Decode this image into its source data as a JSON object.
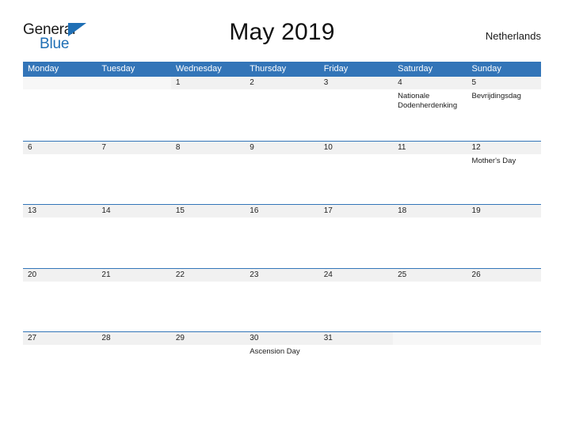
{
  "brand": {
    "name_part1": "General",
    "name_part2": "Blue",
    "flag_icon": "triangle-flag-icon",
    "accent_color": "#1f6fb5"
  },
  "header": {
    "title": "May 2019",
    "country": "Netherlands"
  },
  "colors": {
    "header_band": "#3375b8",
    "day_strip": "#f1f1f1",
    "separator": "#3375b8",
    "text": "#1a1a1a"
  },
  "calendar": {
    "month": "May",
    "year": "2019",
    "weekday_headers": [
      "Monday",
      "Tuesday",
      "Wednesday",
      "Thursday",
      "Friday",
      "Saturday",
      "Sunday"
    ],
    "weeks": [
      {
        "days": [
          {
            "number": "",
            "event": ""
          },
          {
            "number": "",
            "event": ""
          },
          {
            "number": "1",
            "event": ""
          },
          {
            "number": "2",
            "event": ""
          },
          {
            "number": "3",
            "event": ""
          },
          {
            "number": "4",
            "event": "Nationale Dodenherdenking"
          },
          {
            "number": "5",
            "event": "Bevrijdingsdag"
          }
        ]
      },
      {
        "days": [
          {
            "number": "6",
            "event": ""
          },
          {
            "number": "7",
            "event": ""
          },
          {
            "number": "8",
            "event": ""
          },
          {
            "number": "9",
            "event": ""
          },
          {
            "number": "10",
            "event": ""
          },
          {
            "number": "11",
            "event": ""
          },
          {
            "number": "12",
            "event": "Mother's Day"
          }
        ]
      },
      {
        "days": [
          {
            "number": "13",
            "event": ""
          },
          {
            "number": "14",
            "event": ""
          },
          {
            "number": "15",
            "event": ""
          },
          {
            "number": "16",
            "event": ""
          },
          {
            "number": "17",
            "event": ""
          },
          {
            "number": "18",
            "event": ""
          },
          {
            "number": "19",
            "event": ""
          }
        ]
      },
      {
        "days": [
          {
            "number": "20",
            "event": ""
          },
          {
            "number": "21",
            "event": ""
          },
          {
            "number": "22",
            "event": ""
          },
          {
            "number": "23",
            "event": ""
          },
          {
            "number": "24",
            "event": ""
          },
          {
            "number": "25",
            "event": ""
          },
          {
            "number": "26",
            "event": ""
          }
        ]
      },
      {
        "days": [
          {
            "number": "27",
            "event": ""
          },
          {
            "number": "28",
            "event": ""
          },
          {
            "number": "29",
            "event": ""
          },
          {
            "number": "30",
            "event": "Ascension Day"
          },
          {
            "number": "31",
            "event": ""
          },
          {
            "number": "",
            "event": ""
          },
          {
            "number": "",
            "event": ""
          }
        ]
      }
    ]
  }
}
